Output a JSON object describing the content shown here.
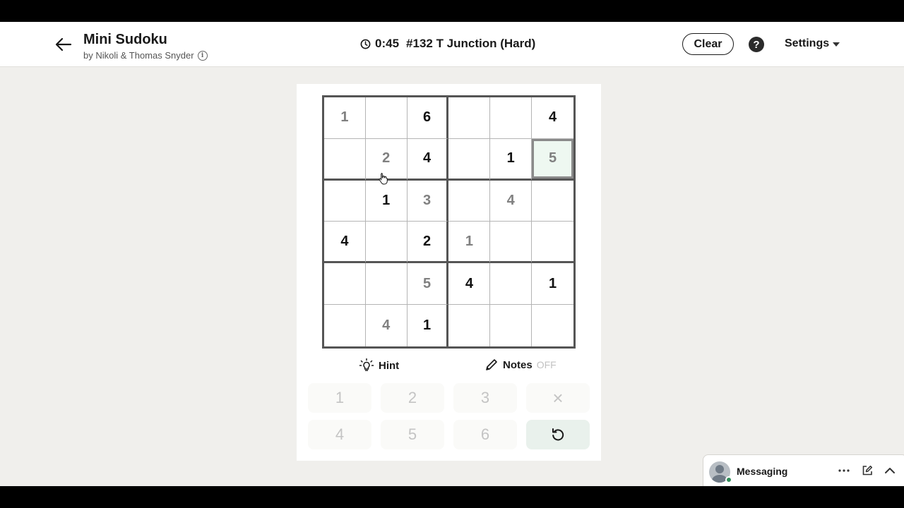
{
  "header": {
    "title": "Mini Sudoku",
    "byline": "by Nikoli & Thomas Snyder",
    "timer": "0:45",
    "puzzle_name": "#132 T Junction (Hard)",
    "clear_label": "Clear",
    "help_label": "?",
    "settings_label": "Settings"
  },
  "board": {
    "rows": [
      [
        {
          "v": "1",
          "given": false
        },
        {
          "v": "",
          "given": false
        },
        {
          "v": "6",
          "given": true
        },
        {
          "v": "",
          "given": false
        },
        {
          "v": "",
          "given": false
        },
        {
          "v": "4",
          "given": true
        }
      ],
      [
        {
          "v": "",
          "given": false
        },
        {
          "v": "2",
          "given": false
        },
        {
          "v": "4",
          "given": true
        },
        {
          "v": "",
          "given": false
        },
        {
          "v": "1",
          "given": true
        },
        {
          "v": "5",
          "given": false
        }
      ],
      [
        {
          "v": "",
          "given": false
        },
        {
          "v": "1",
          "given": true
        },
        {
          "v": "3",
          "given": false
        },
        {
          "v": "",
          "given": false
        },
        {
          "v": "4",
          "given": false
        },
        {
          "v": "",
          "given": false
        }
      ],
      [
        {
          "v": "4",
          "given": true
        },
        {
          "v": "",
          "given": false
        },
        {
          "v": "2",
          "given": true
        },
        {
          "v": "1",
          "given": false
        },
        {
          "v": "",
          "given": false
        },
        {
          "v": "",
          "given": false
        }
      ],
      [
        {
          "v": "",
          "given": false
        },
        {
          "v": "",
          "given": false
        },
        {
          "v": "5",
          "given": false
        },
        {
          "v": "4",
          "given": true
        },
        {
          "v": "",
          "given": false
        },
        {
          "v": "1",
          "given": true
        }
      ],
      [
        {
          "v": "",
          "given": false
        },
        {
          "v": "4",
          "given": false
        },
        {
          "v": "1",
          "given": true
        },
        {
          "v": "",
          "given": false
        },
        {
          "v": "",
          "given": false
        },
        {
          "v": "",
          "given": false
        }
      ]
    ],
    "selected": {
      "row": 1,
      "col": 5
    }
  },
  "tools": {
    "hint_label": "Hint",
    "notes_label": "Notes",
    "notes_state": "OFF"
  },
  "keypad": {
    "keys": [
      "1",
      "2",
      "3",
      "×",
      "4",
      "5",
      "6"
    ]
  },
  "messaging": {
    "label": "Messaging"
  },
  "colors": {
    "given_digit": "#111111",
    "user_digit": "#808080",
    "selected_cell_bg": "#eef8f1",
    "page_bg": "#f0efec",
    "online": "#2e8b57"
  }
}
